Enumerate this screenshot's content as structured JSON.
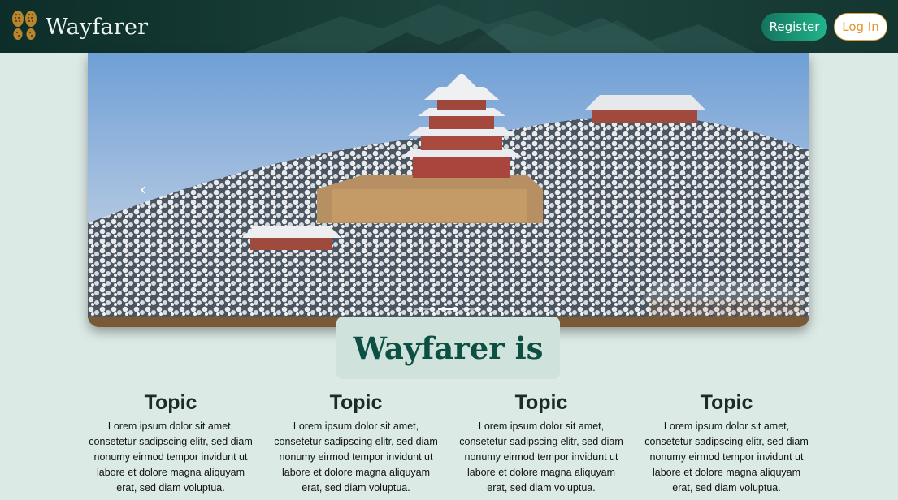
{
  "navbar": {
    "brand_name": "Wayfarer",
    "register_label": "Register",
    "login_label": "Log In"
  },
  "carousel": {
    "prev_glyph": "‹",
    "next_glyph": "›",
    "indicators": [
      "slide-1",
      "slide-2",
      "slide-3"
    ],
    "active_index": 1
  },
  "intro": {
    "title": "Wayfarer is"
  },
  "topics": [
    {
      "title": "Topic",
      "text": "Lorem ipsum dolor sit amet, consetetur sadipscing elitr, sed diam nonumy eirmod tempor invidunt ut labore et dolore magna aliquyam erat, sed diam voluptua."
    },
    {
      "title": "Topic",
      "text": "Lorem ipsum dolor sit amet, consetetur sadipscing elitr, sed diam nonumy eirmod tempor invidunt ut labore et dolore magna aliquyam erat, sed diam voluptua."
    },
    {
      "title": "Topic",
      "text": "Lorem ipsum dolor sit amet, consetetur sadipscing elitr, sed diam nonumy eirmod tempor invidunt ut labore et dolore magna aliquyam erat, sed diam voluptua."
    },
    {
      "title": "Topic",
      "text": "Lorem ipsum dolor sit amet, consetetur sadipscing elitr, sed diam nonumy eirmod tempor invidunt ut labore et dolore magna aliquyam erat, sed diam voluptua."
    }
  ],
  "colors": {
    "page_background": "#dceae6",
    "navbar_dark": "#163a34",
    "register_green": "#1c9b79",
    "login_orange": "#e3962c",
    "intro_title": "#0d4f42"
  },
  "icons": {
    "brand_logo": "footprints-icon",
    "prev": "chevron-left-icon",
    "next": "chevron-right-icon"
  }
}
